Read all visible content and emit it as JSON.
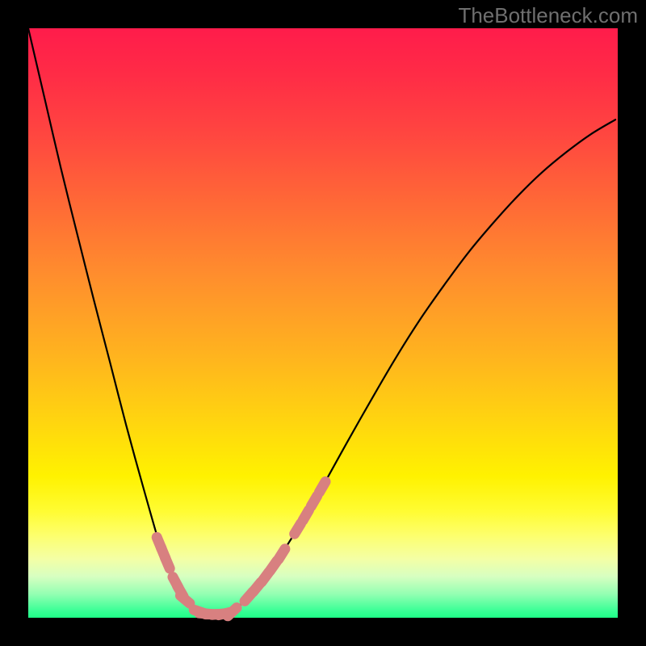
{
  "watermark": "TheBottleneck.com",
  "chart_data": {
    "type": "line",
    "title": "",
    "xlabel": "",
    "ylabel": "",
    "xlim": [
      0,
      1
    ],
    "ylim": [
      0,
      1
    ],
    "series": [
      {
        "name": "left-branch",
        "x": [
          0.0,
          0.028,
          0.055,
          0.083,
          0.111,
          0.139,
          0.166,
          0.194,
          0.222,
          0.229,
          0.236,
          0.243,
          0.25,
          0.258,
          0.266,
          0.277,
          0.291
        ],
        "y": [
          1.0,
          0.88,
          0.764,
          0.651,
          0.54,
          0.432,
          0.327,
          0.225,
          0.127,
          0.11,
          0.093,
          0.076,
          0.06,
          0.045,
          0.031,
          0.019,
          0.01
        ]
      },
      {
        "name": "trough",
        "x": [
          0.291,
          0.3,
          0.311,
          0.322,
          0.333,
          0.346
        ],
        "y": [
          0.01,
          0.007,
          0.006,
          0.006,
          0.007,
          0.01
        ]
      },
      {
        "name": "right-branch",
        "x": [
          0.346,
          0.36,
          0.374,
          0.388,
          0.402,
          0.416,
          0.43,
          0.443,
          0.457,
          0.471,
          0.485,
          0.499,
          0.54,
          0.582,
          0.623,
          0.664,
          0.706,
          0.747,
          0.789,
          0.83,
          0.871,
          0.913,
          0.954,
          0.996
        ],
        "y": [
          0.01,
          0.022,
          0.036,
          0.052,
          0.069,
          0.088,
          0.108,
          0.129,
          0.151,
          0.174,
          0.198,
          0.222,
          0.296,
          0.37,
          0.44,
          0.505,
          0.565,
          0.62,
          0.67,
          0.715,
          0.755,
          0.79,
          0.82,
          0.845
        ]
      }
    ],
    "dot_series": {
      "name": "highlighted-points",
      "color": "#d88080",
      "points": [
        {
          "x": 0.222,
          "y": 0.127
        },
        {
          "x": 0.229,
          "y": 0.11
        },
        {
          "x": 0.236,
          "y": 0.093
        },
        {
          "x": 0.25,
          "y": 0.06
        },
        {
          "x": 0.258,
          "y": 0.045
        },
        {
          "x": 0.266,
          "y": 0.031
        },
        {
          "x": 0.291,
          "y": 0.01
        },
        {
          "x": 0.3,
          "y": 0.007
        },
        {
          "x": 0.311,
          "y": 0.006
        },
        {
          "x": 0.322,
          "y": 0.006
        },
        {
          "x": 0.333,
          "y": 0.007
        },
        {
          "x": 0.346,
          "y": 0.01
        },
        {
          "x": 0.374,
          "y": 0.036
        },
        {
          "x": 0.388,
          "y": 0.052
        },
        {
          "x": 0.402,
          "y": 0.069
        },
        {
          "x": 0.416,
          "y": 0.088
        },
        {
          "x": 0.43,
          "y": 0.108
        },
        {
          "x": 0.457,
          "y": 0.151
        },
        {
          "x": 0.471,
          "y": 0.174
        },
        {
          "x": 0.485,
          "y": 0.198
        },
        {
          "x": 0.499,
          "y": 0.222
        }
      ]
    },
    "gradient_stops": [
      {
        "pos": 0.0,
        "color": "#ff1c4b"
      },
      {
        "pos": 0.3,
        "color": "#ff6a36"
      },
      {
        "pos": 0.67,
        "color": "#ffd60f"
      },
      {
        "pos": 0.86,
        "color": "#fdff6d"
      },
      {
        "pos": 1.0,
        "color": "#1eff87"
      }
    ]
  }
}
